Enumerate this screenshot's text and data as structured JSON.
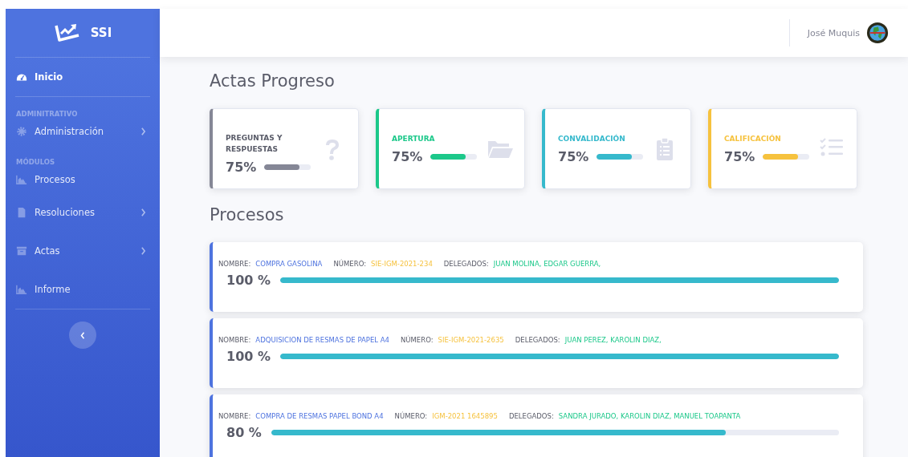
{
  "sidebar": {
    "brand": "SSI",
    "sections": [
      [
        {
          "kind": "link",
          "label": "Inicio",
          "selected": true,
          "has_submenu": false
        }
      ],
      [
        {
          "kind": "heading",
          "label": "ADMINITRATIVO"
        },
        {
          "kind": "link",
          "label": "Administración",
          "selected": false,
          "has_submenu": true
        },
        {
          "kind": "heading",
          "label": "MÓDULOS"
        },
        {
          "kind": "link",
          "label": "Procesos",
          "selected": false,
          "has_submenu": false
        },
        {
          "kind": "link",
          "label": "Resoluciones",
          "selected": false,
          "has_submenu": true
        },
        {
          "kind": "link",
          "label": "Actas",
          "selected": false,
          "has_submenu": true
        },
        {
          "kind": "link",
          "label": "Informe",
          "selected": false,
          "has_submenu": false
        }
      ]
    ]
  },
  "topbar": {
    "user_name": "José Muquis"
  },
  "summary": {
    "title": "Actas Progreso",
    "cards": [
      {
        "label": "PREGUNTAS Y RESPUESTAS",
        "value": "75%",
        "level": 0.75,
        "color": "#858796"
      },
      {
        "label": "APERTURA",
        "value": "75%",
        "level": 0.75,
        "color": "#1cc88a"
      },
      {
        "label": "CONVALIDACIÓN",
        "value": "75%",
        "level": 0.75,
        "color": "#36b9cc"
      },
      {
        "label": "CALIFICACIÓN",
        "value": "75%",
        "level": 0.75,
        "color": "#f6c23e"
      }
    ]
  },
  "processes": {
    "title": "Procesos",
    "rows": [
      {
        "name_label": "NOMBRE:",
        "name": "COMPRA GASOLINA",
        "number_label": "NÚMERO:",
        "number": "SIE-IGM-2021-234",
        "delegates_label": "DELEGADOS:",
        "delegates": "JUAN MOLINA, EDGAR GUERRA,",
        "percent": "100 %",
        "level": 1
      },
      {
        "name_label": "NOMBRE:",
        "name": "ADQUISICION DE RESMAS DE PAPEL A4",
        "number_label": "NÚMERO:",
        "number": "SIE-IGM-2021-2635",
        "delegates_label": "DELEGADOS:",
        "delegates": "JUAN PEREZ, KAROLIN DIAZ,",
        "percent": "100 %",
        "level": 1
      },
      {
        "name_label": "NOMBRE:",
        "name": "COMPRA DE RESMAS PAPEL BOND A4",
        "number_label": "NÚMERO:",
        "number": "IGM-2021 1645895",
        "delegates_label": "DELEGADOS:",
        "delegates": "SANDRA JURADO, KAROLIN DIAZ, MANUEL TOAPANTA",
        "percent": "80 %",
        "level": 0.8
      }
    ]
  }
}
